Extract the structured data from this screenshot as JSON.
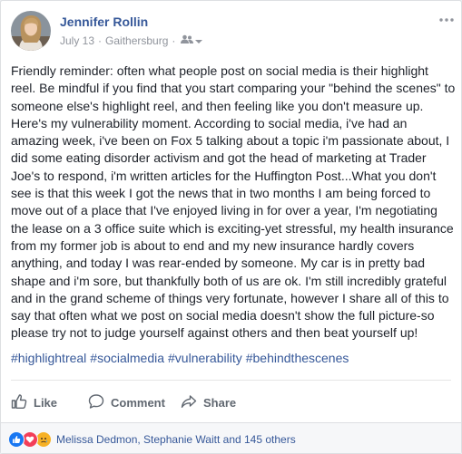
{
  "post": {
    "author": "Jennifer Rollin",
    "date": "July 13",
    "separator": "·",
    "location": "Gaithersburg",
    "body": "Friendly reminder: often what people post on social media is their highlight reel. Be mindful if you find that you start comparing your \"behind the scenes\" to someone else's highlight reel, and then feeling like you don't measure up. Here's my vulnerability moment. According to social media, i've had an amazing week, i've been on Fox 5 talking about a topic i'm passionate about, I did some eating disorder activism and got the head of marketing at Trader Joe's to respond, i'm written articles for the Huffington Post...What you don't see is that this week I got the news that in two months I am being forced to move out of a place that I've enjoyed living in for over a year, I'm negotiating the lease on a 3 office suite which is exciting-yet stressful, my health insurance from my former job is about to end and my new insurance hardly covers anything, and today I was rear-ended by someone. My car is in pretty bad shape and i'm sore, but thankfully both of us are ok. I'm still incredibly grateful and in the grand scheme of things very fortunate, however I share all of this to say that often what we post on social media doesn't show the full picture-so please try not to judge yourself against others and then beat yourself up!",
    "hashtags": [
      "#highlightreal",
      "#socialmedia",
      "#vulnerability",
      "#behindthescenes"
    ]
  },
  "actions": {
    "like": "Like",
    "comment": "Comment",
    "share": "Share"
  },
  "reactions": {
    "icons": [
      "like-reaction-icon",
      "love-reaction-icon",
      "sad-reaction-icon"
    ],
    "summary": "Melissa Dedmon, Stephanie Waitt and 145 others"
  },
  "colors": {
    "name_link": "#365899",
    "body_text": "#1d2129",
    "meta": "#90949c",
    "action": "#606770",
    "like_blue": "#1877f2",
    "love_red": "#f33e58",
    "sad_yellow": "#f7b125"
  }
}
